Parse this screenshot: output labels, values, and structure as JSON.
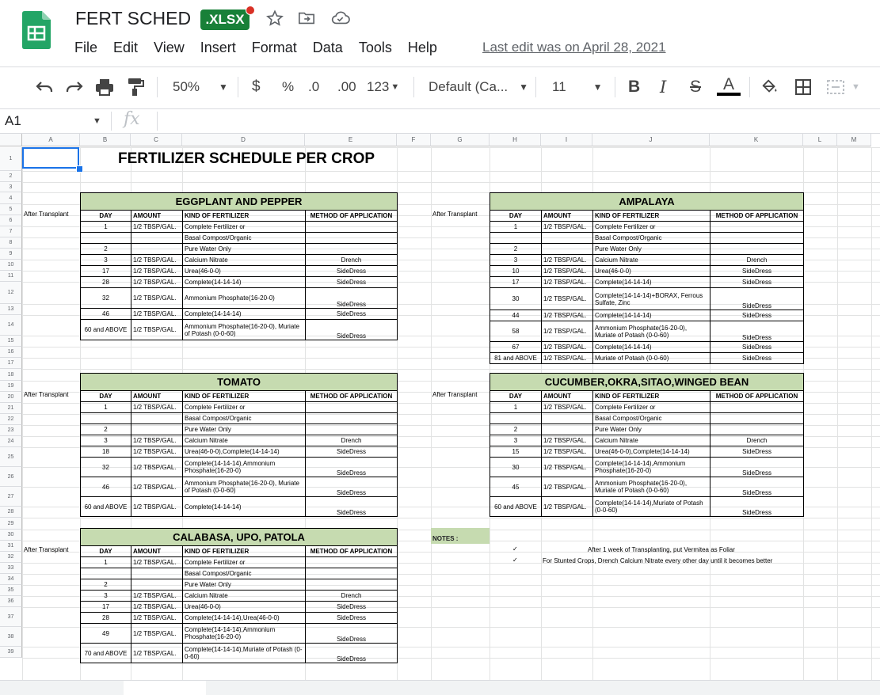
{
  "app": {
    "doc_title": "FERT SCHED",
    "badge": ".XLSX",
    "menu": [
      "File",
      "Edit",
      "View",
      "Insert",
      "Format",
      "Data",
      "Tools",
      "Help"
    ],
    "last_edit": "Last edit was on April 28, 2021",
    "colors": {
      "brand": "#188038",
      "accent": "#1a73e8",
      "table_header": "#c6dbb0"
    }
  },
  "toolbar": {
    "zoom": "50%",
    "currency": "$",
    "percent": "%",
    "dec_decrease": ".0",
    "dec_increase": ".00",
    "format_more": "123",
    "font": "Default (Ca...",
    "font_size": "11",
    "bold": "B",
    "italic": "I",
    "strike": "S",
    "text_color": "A"
  },
  "formula_bar": {
    "cell_ref": "A1",
    "fx": "fx"
  },
  "columns": [
    "A",
    "B",
    "C",
    "D",
    "E",
    "F",
    "G",
    "H",
    "I",
    "J",
    "K",
    "L",
    "M"
  ],
  "rows": [
    "1",
    "2",
    "3",
    "4",
    "5",
    "6",
    "7",
    "8",
    "9",
    "10",
    "11",
    "12",
    "13",
    "14",
    "15",
    "16",
    "17",
    "18",
    "19",
    "20",
    "21",
    "22",
    "23",
    "24",
    "25",
    "26",
    "27",
    "28",
    "29",
    "30",
    "31",
    "32",
    "33",
    "34",
    "35",
    "36",
    "37",
    "38",
    "39"
  ],
  "sheet": {
    "title": "FERTILIZER SCHEDULE PER CROP",
    "after_transplant": "After Transplant",
    "headers": {
      "day": "DAY",
      "amount": "AMOUNT",
      "kind": "KIND OF FERTILIZER",
      "method": "METHOD OF APPLICATION"
    },
    "tables": [
      {
        "title": "EGGPLANT AND PEPPER",
        "rows": [
          [
            "1",
            "1/2 TBSP/GAL.",
            "Complete Fertilizer or",
            ""
          ],
          [
            "",
            "",
            "Basal Compost/Organic",
            ""
          ],
          [
            "2",
            "",
            "Pure Water Only",
            ""
          ],
          [
            "3",
            "1/2 TBSP/GAL.",
            "Calcium Nitrate",
            "Drench"
          ],
          [
            "17",
            "1/2 TBSP/GAL.",
            "Urea(46-0-0)",
            "SideDress"
          ],
          [
            "28",
            "1/2 TBSP/GAL.",
            "Complete(14-14-14)",
            "SideDress"
          ],
          [
            "32",
            "1/2 TBSP/GAL.",
            "Ammonium Phosphate(16-20-0)",
            "SideDress"
          ],
          [
            "46",
            "1/2 TBSP/GAL.",
            "Complete(14-14-14)",
            "SideDress"
          ],
          [
            "60 and ABOVE",
            "1/2 TBSP/GAL.",
            "Ammonium Phosphate(16-20-0), Muriate of Potash (0-0-60)",
            "SideDress"
          ]
        ]
      },
      {
        "title": "AMPALAYA",
        "rows": [
          [
            "1",
            "1/2 TBSP/GAL.",
            "Complete Fertilizer or",
            ""
          ],
          [
            "",
            "",
            "Basal Compost/Organic",
            ""
          ],
          [
            "2",
            "",
            "Pure Water Only",
            ""
          ],
          [
            "3",
            "1/2 TBSP/GAL.",
            "Calcium Nitrate",
            "Drench"
          ],
          [
            "10",
            "1/2 TBSP/GAL.",
            "Urea(46-0-0)",
            "SideDress"
          ],
          [
            "17",
            "1/2 TBSP/GAL.",
            "Complete(14-14-14)",
            "SideDress"
          ],
          [
            "30",
            "1/2 TBSP/GAL.",
            "Complete(14-14-14)+BORAX, Ferrous Sulfate, Zinc",
            "SideDress"
          ],
          [
            "44",
            "1/2 TBSP/GAL.",
            "Complete(14-14-14)",
            "SideDress"
          ],
          [
            "58",
            "1/2 TBSP/GAL.",
            "Ammonium Phosphate(16-20-0), Muriate of Potash (0-0-60)",
            "SideDress"
          ],
          [
            "67",
            "1/2 TBSP/GAL.",
            "Complete(14-14-14)",
            "SideDress"
          ],
          [
            "81 and ABOVE",
            "1/2 TBSP/GAL.",
            "Muriate of Potash (0-0-60)",
            "SideDress"
          ]
        ]
      },
      {
        "title": "TOMATO",
        "rows": [
          [
            "1",
            "1/2 TBSP/GAL.",
            "Complete Fertilizer or",
            ""
          ],
          [
            "",
            "",
            "Basal Compost/Organic",
            ""
          ],
          [
            "2",
            "",
            "Pure Water Only",
            ""
          ],
          [
            "3",
            "1/2 TBSP/GAL.",
            "Calcium Nitrate",
            "Drench"
          ],
          [
            "18",
            "1/2 TBSP/GAL.",
            "Urea(46-0-0),Complete(14-14-14)",
            "SideDress"
          ],
          [
            "32",
            "1/2 TBSP/GAL.",
            "Complete(14-14-14),Ammonium Phosphate(16-20-0)",
            "SideDress"
          ],
          [
            "46",
            "1/2 TBSP/GAL.",
            "Ammonium Phosphate(16-20-0), Muriate of Potash (0-0-60)",
            "SideDress"
          ],
          [
            "60 and ABOVE",
            "1/2 TBSP/GAL.",
            "Complete(14-14-14)",
            "SideDress"
          ]
        ]
      },
      {
        "title": "CUCUMBER,OKRA,SITAO,WINGED BEAN",
        "rows": [
          [
            "1",
            "1/2 TBSP/GAL.",
            "Complete Fertilizer or",
            ""
          ],
          [
            "",
            "",
            "Basal Compost/Organic",
            ""
          ],
          [
            "2",
            "",
            "Pure Water Only",
            ""
          ],
          [
            "3",
            "1/2 TBSP/GAL.",
            "Calcium Nitrate",
            "Drench"
          ],
          [
            "15",
            "1/2 TBSP/GAL.",
            "Urea(46-0-0),Complete(14-14-14)",
            "SideDress"
          ],
          [
            "30",
            "1/2 TBSP/GAL.",
            "Complete(14-14-14),Ammonium Phosphate(16-20-0)",
            "SideDress"
          ],
          [
            "45",
            "1/2 TBSP/GAL.",
            "Ammonium Phosphate(16-20-0), Muriate of Potash (0-0-60)",
            "SideDress"
          ],
          [
            "60 and ABOVE",
            "1/2 TBSP/GAL.",
            "Complete(14-14-14),Muriate of Potash (0-0-60)",
            "SideDress"
          ]
        ]
      },
      {
        "title": "CALABASA, UPO, PATOLA",
        "rows": [
          [
            "1",
            "1/2 TBSP/GAL.",
            "Complete Fertilizer or",
            ""
          ],
          [
            "",
            "",
            "Basal Compost/Organic",
            ""
          ],
          [
            "2",
            "",
            "Pure Water Only",
            ""
          ],
          [
            "3",
            "1/2 TBSP/GAL.",
            "Calcium Nitrate",
            "Drench"
          ],
          [
            "17",
            "1/2 TBSP/GAL.",
            "Urea(46-0-0)",
            "SideDress"
          ],
          [
            "28",
            "1/2 TBSP/GAL.",
            "Complete(14-14-14),Urea(46-0-0)",
            "SideDress"
          ],
          [
            "49",
            "1/2 TBSP/GAL.",
            "Complete(14-14-14),Ammonium Phosphate(16-20-0)",
            "SideDress"
          ],
          [
            "70 and ABOVE",
            "1/2 TBSP/GAL.",
            "Complete(14-14-14),Muriate of Potash (0-0-60)",
            "SideDress"
          ]
        ]
      }
    ],
    "notes": {
      "label": "NOTES :",
      "check": "✓",
      "items": [
        "After 1 week of Transplanting, put Vermitea as Foliar",
        "For Stunted Crops, Drench Calcium Nitrate every other day until it becomes better"
      ]
    }
  }
}
